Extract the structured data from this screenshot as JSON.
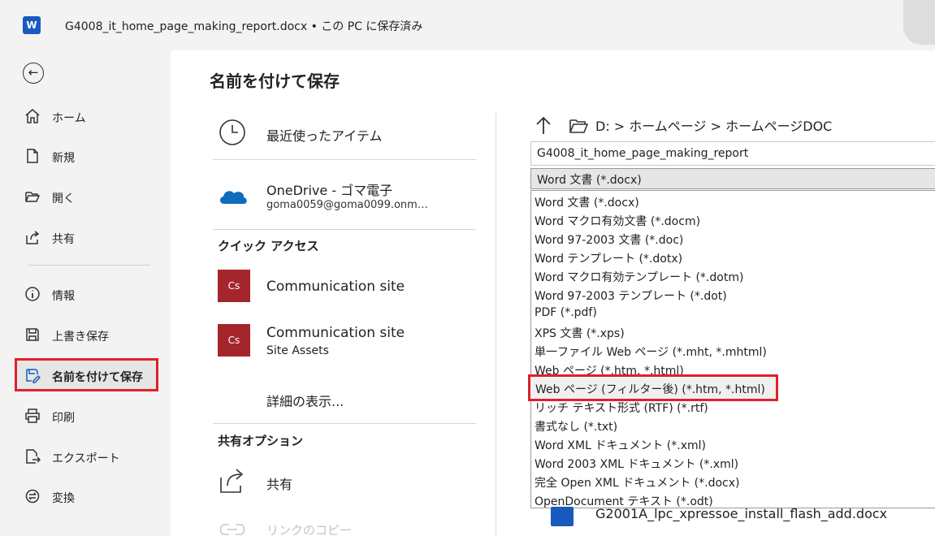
{
  "window": {
    "title": "G4008_it_home_page_making_report.docx • この PC に保存済み",
    "app_icon": "word-icon"
  },
  "sidebar": {
    "back": "←",
    "items": [
      {
        "label": "ホーム",
        "icon": "home-icon"
      },
      {
        "label": "新規",
        "icon": "new-doc-icon"
      },
      {
        "label": "開く",
        "icon": "folder-open-icon"
      },
      {
        "label": "共有",
        "icon": "share-icon"
      },
      {
        "label": "情報",
        "icon": "info-icon"
      },
      {
        "label": "上書き保存",
        "icon": "save-icon"
      },
      {
        "label": "名前を付けて保存",
        "icon": "save-as-icon"
      },
      {
        "label": "印刷",
        "icon": "print-icon"
      },
      {
        "label": "エクスポート",
        "icon": "export-icon"
      },
      {
        "label": "変換",
        "icon": "convert-icon"
      }
    ]
  },
  "main": {
    "title": "名前を付けて保存",
    "recent": "最近使ったアイテム",
    "onedrive": {
      "name": "OneDrive - ゴマ電子",
      "account": "goma0059@goma0099.onm…"
    },
    "quick_access": {
      "heading": "クイック アクセス",
      "items": [
        {
          "tile": "Cs",
          "name": "Communication site",
          "sub": ""
        },
        {
          "tile": "Cs",
          "name": "Communication site",
          "sub": "Site Assets"
        }
      ]
    },
    "more": "詳細の表示...",
    "share_options": {
      "heading": "共有オプション",
      "share": "共有",
      "copy_link": "リンクのコピー"
    }
  },
  "save_panel": {
    "path": "D: > ホームページ > ホームページDOC",
    "filename": "G4008_it_home_page_making_report",
    "selected_type": "Word 文書 (*.docx)",
    "options": [
      "Word 文書 (*.docx)",
      "Word マクロ有効文書 (*.docm)",
      "Word 97-2003 文書 (*.doc)",
      "Word テンプレート (*.dotx)",
      "Word マクロ有効テンプレート (*.dotm)",
      "Word 97-2003 テンプレート (*.dot)",
      "PDF (*.pdf)",
      "XPS 文書 (*.xps)",
      "単一ファイル Web ページ (*.mht, *.mhtml)",
      "Web ページ (*.htm, *.html)",
      "Web ページ (フィルター後) (*.htm, *.html)",
      "リッチ テキスト形式 (RTF) (*.rtf)",
      "書式なし (*.txt)",
      "Word XML ドキュメント (*.xml)",
      "Word 2003 XML ドキュメント (*.xml)",
      "完全 Open XML ドキュメント (*.docx)",
      "OpenDocument テキスト (*.odt)"
    ],
    "highlighted_index": 10,
    "bottom_file": "G2001A_lpc_xpressoe_install_flash_add.docx"
  },
  "colors": {
    "highlight": "#e0202a",
    "word_blue": "#185abd",
    "tile": "#a4262c"
  }
}
